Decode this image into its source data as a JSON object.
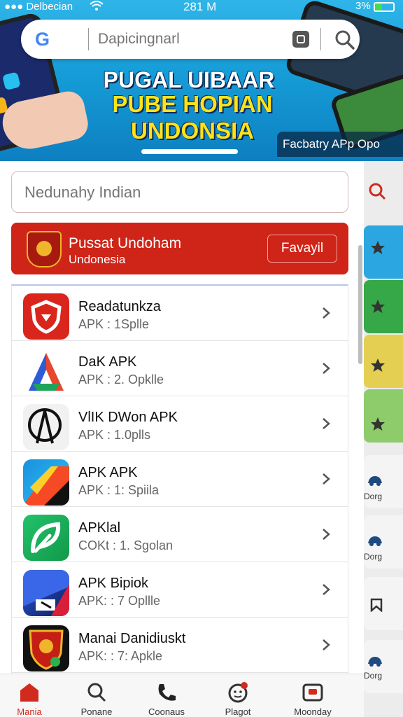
{
  "status_bar": {
    "carrier": "●●● Delbecian",
    "time": "281 M",
    "battery": "3%"
  },
  "banner": {
    "search_placeholder": "Dapicingnarl",
    "google_logo": "G",
    "headline_line1": "PUGAL UIBAAR",
    "headline_line2": "PUBE HOPIAN UNDONSIA",
    "tag": "Facbatry APp Opo"
  },
  "search_field": {
    "placeholder": "Nedunahy Indian"
  },
  "promo": {
    "title": "Pussat Undoham",
    "subtitle": "Undonesia",
    "button": "Favayil"
  },
  "apps": [
    {
      "name": "Readatunkza",
      "sub": "APK : 1Splle",
      "icon": "shield-icon",
      "color": "#d9251c"
    },
    {
      "name": "DaK APK",
      "sub": "APK : 2. Opklle",
      "icon": "triangle-a-icon",
      "color": "#2f5bd6"
    },
    {
      "name": "VlIK DWon APK",
      "sub": "APK : 1.0plls",
      "icon": "circle-a-icon",
      "color": "#111111"
    },
    {
      "name": "APK APK",
      "sub": "APK : 1: Spiila",
      "icon": "colorful-icon",
      "color": "#1a8fe0"
    },
    {
      "name": "APKlal",
      "sub": "COKt : 1. Sgolan",
      "icon": "leaf-icon",
      "color": "#1bb04f"
    },
    {
      "name": "APK Bipiok",
      "sub": "APK: : 7 Opllle",
      "icon": "box-icon",
      "color": "#1d3fa0"
    },
    {
      "name": "Manai Danidiuskt",
      "sub": "APK: : 7: Apkle",
      "icon": "crest-icon",
      "color": "#c51f15"
    }
  ],
  "rail": {
    "labels": [
      "Dorg",
      "Dorg",
      "Dorg"
    ],
    "colors": [
      "#2ba6e0",
      "#36a847",
      "#e4cf53",
      "#8ecb6a"
    ]
  },
  "nav": [
    {
      "label": "Mania",
      "icon": "home-icon",
      "active": true
    },
    {
      "label": "Ponane",
      "icon": "search-icon",
      "active": false
    },
    {
      "label": "Coonaus",
      "icon": "phone-icon",
      "active": false
    },
    {
      "label": "Plagot",
      "icon": "face-icon",
      "active": false
    },
    {
      "label": "Moonday",
      "icon": "tv-icon",
      "active": false
    }
  ],
  "colors": {
    "accent": "#d12a1e",
    "banner": "#169dd8"
  }
}
